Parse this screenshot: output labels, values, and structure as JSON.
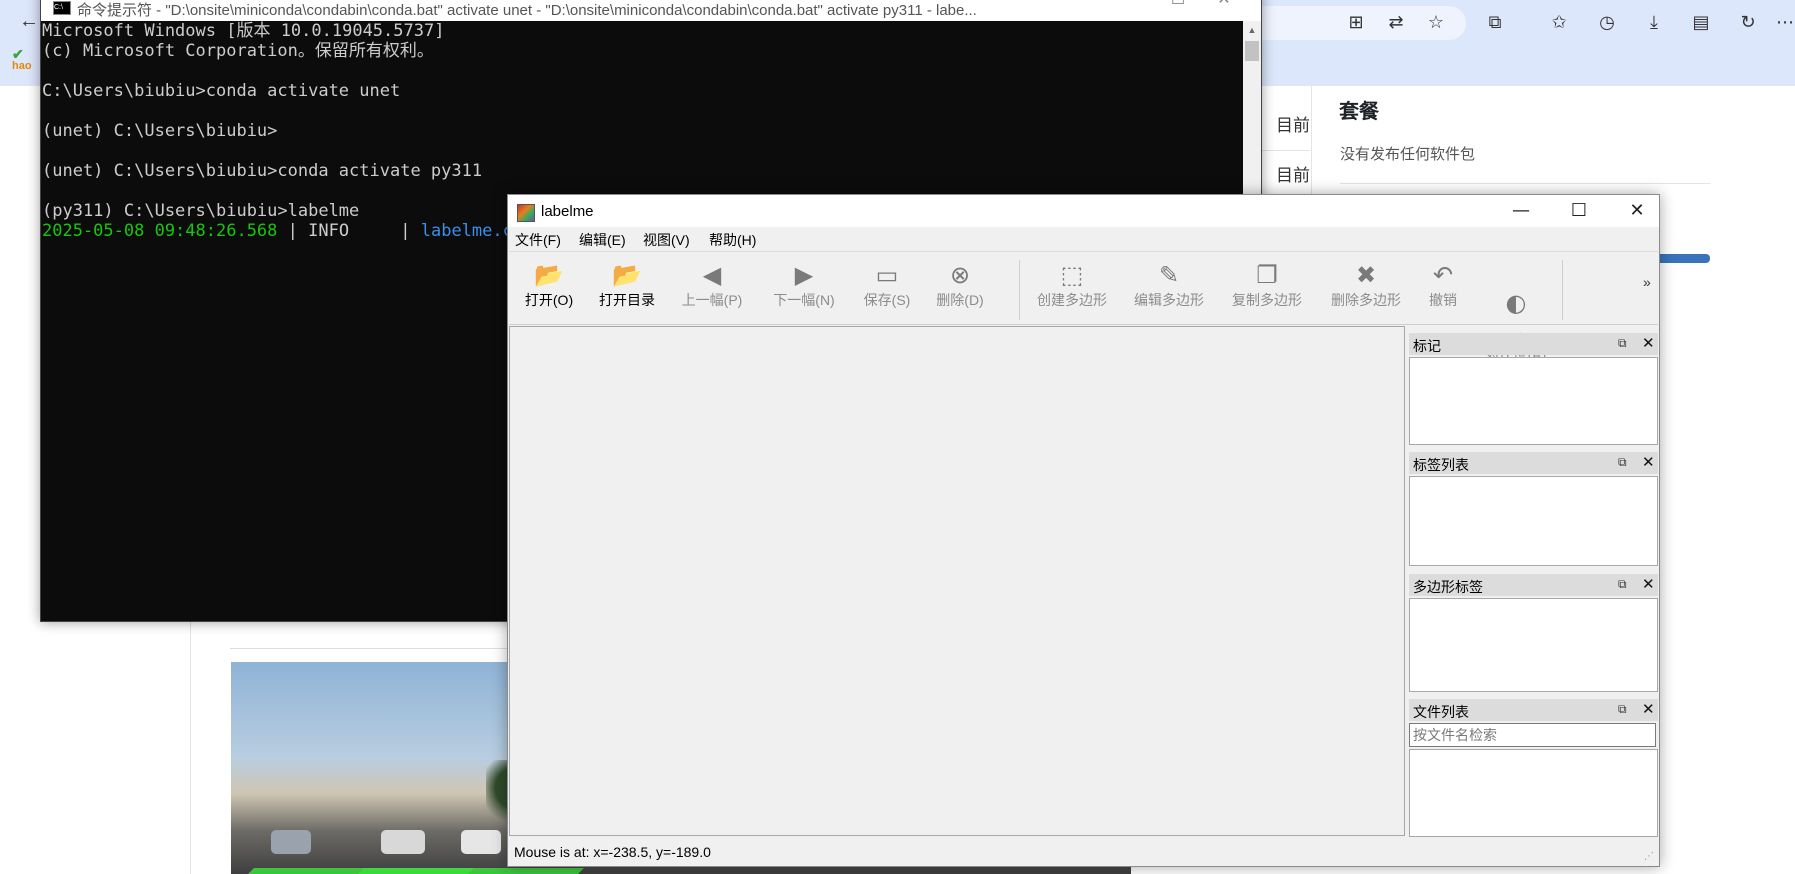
{
  "browser": {
    "back_glyph": "←",
    "hao_logo": "hao",
    "toolbar_icons": [
      {
        "name": "install-app-icon",
        "glyph": "⊞"
      },
      {
        "name": "translate-icon",
        "glyph": "⇄"
      },
      {
        "name": "favorite-star-icon",
        "glyph": "☆"
      },
      {
        "name": "extensions-icon",
        "glyph": "⧉"
      },
      {
        "name": "favorites-icon",
        "glyph": "✩"
      },
      {
        "name": "history-icon",
        "glyph": "◷"
      },
      {
        "name": "downloads-icon",
        "glyph": "⤓"
      },
      {
        "name": "reading-view-icon",
        "glyph": "▤"
      },
      {
        "name": "performance-icon",
        "glyph": "↻"
      },
      {
        "name": "more-icon",
        "glyph": "⋯"
      }
    ],
    "side_rows": [
      "目前",
      "目前"
    ],
    "packages_title": "套餐",
    "packages_text": "没有发布任何软件包"
  },
  "cmd": {
    "title": "命令提示符 - \"D:\\onsite\\miniconda\\condabin\\conda.bat\" activate unet - \"D:\\onsite\\miniconda\\condabin\\conda.bat\" activate py311 - labe...",
    "minimize_glyph": "—",
    "maximize_glyph": "☐",
    "close_glyph": "✕",
    "lines": [
      "Microsoft Windows [版本 10.0.19045.5737]",
      "(c) Microsoft Corporation。保留所有权利。",
      "",
      "C:\\Users\\biubiu>conda activate unet",
      "",
      "(unet) C:\\Users\\biubiu>",
      "",
      "(unet) C:\\Users\\biubiu>conda activate py311",
      "",
      "(py311) C:\\Users\\biubiu>labelme"
    ],
    "log": {
      "time": "2025-05-08 09:48:26.568",
      "sep1": " | ",
      "level": "INFO    ",
      "sep2": " | ",
      "module": "labelme.co"
    },
    "scroll_up_glyph": "▲"
  },
  "labelme": {
    "title": "labelme",
    "minimize_glyph": "—",
    "maximize_glyph": "☐",
    "close_glyph": "✕",
    "menus": [
      "文件(F)",
      "编辑(E)",
      "视图(V)",
      "帮助(H)"
    ],
    "tools": [
      {
        "label": "打开(O)",
        "icon": "open-folder-icon",
        "glyph": "📂",
        "enabled": true
      },
      {
        "label": "打开目录",
        "icon": "open-dir-icon",
        "glyph": "📂",
        "enabled": true
      },
      {
        "label": "上一幅(P)",
        "icon": "prev-arrow-icon",
        "glyph": "◀",
        "enabled": false
      },
      {
        "label": "下一幅(N)",
        "icon": "next-arrow-icon",
        "glyph": "▶",
        "enabled": false
      },
      {
        "label": "保存(S)",
        "icon": "save-icon",
        "glyph": "▭",
        "enabled": false
      },
      {
        "label": "删除(D)",
        "icon": "delete-icon",
        "glyph": "⊗",
        "enabled": false
      },
      {
        "label": "创建多边形",
        "icon": "create-polygon-icon",
        "glyph": "⬚",
        "enabled": false
      },
      {
        "label": "编辑多边形",
        "icon": "edit-polygon-icon",
        "glyph": "✎",
        "enabled": false
      },
      {
        "label": "复制多边形",
        "icon": "copy-polygon-icon",
        "glyph": "❐",
        "enabled": false
      },
      {
        "label": "删除多边形",
        "icon": "delete-polygon-icon",
        "glyph": "✖",
        "enabled": false
      },
      {
        "label": "撤销",
        "icon": "undo-icon",
        "glyph": "↶",
        "enabled": false
      },
      {
        "label": "亮度\n对比度(B)",
        "icon": "brightness-contrast-icon",
        "glyph": "◐",
        "enabled": false
      }
    ],
    "toolbar_more": "»",
    "docks": [
      {
        "title": "标记",
        "float_glyph": "⧉",
        "close_glyph": "✕"
      },
      {
        "title": "标签列表",
        "float_glyph": "⧉",
        "close_glyph": "✕"
      },
      {
        "title": "多边形标签",
        "float_glyph": "⧉",
        "close_glyph": "✕"
      },
      {
        "title": "文件列表",
        "float_glyph": "⧉",
        "close_glyph": "✕"
      }
    ],
    "file_search_placeholder": "按文件名检索",
    "status": "Mouse is at: x=-238.5, y=-189.0",
    "grip_glyph": "⋰"
  }
}
